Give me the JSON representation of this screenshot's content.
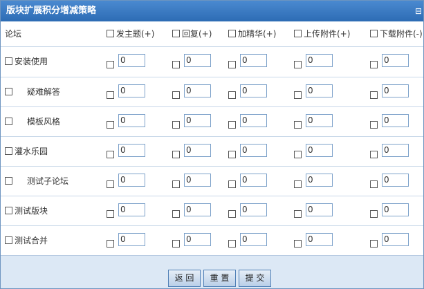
{
  "title": "版块扩展积分增减策略",
  "header": {
    "forum_label": "论坛",
    "columns": [
      "发主题(+)",
      "回复(+)",
      "加精华(+)",
      "上传附件(+)",
      "下载附件(-)"
    ]
  },
  "rows": [
    {
      "label": "安装使用",
      "values": [
        "0",
        "0",
        "0",
        "0",
        "0"
      ]
    },
    {
      "label": "疑难解答",
      "values": [
        "0",
        "0",
        "0",
        "0",
        "0"
      ]
    },
    {
      "label": "模板风格",
      "values": [
        "0",
        "0",
        "0",
        "0",
        "0"
      ]
    },
    {
      "label": "灌水乐园",
      "values": [
        "0",
        "0",
        "0",
        "0",
        "0"
      ]
    },
    {
      "label": "测试子论坛",
      "values": [
        "0",
        "0",
        "0",
        "0",
        "0"
      ]
    },
    {
      "label": "测试版块",
      "values": [
        "0",
        "0",
        "0",
        "0",
        "0"
      ]
    },
    {
      "label": "测试合并",
      "values": [
        "0",
        "0",
        "0",
        "0",
        "0"
      ]
    }
  ],
  "buttons": {
    "back": "返 回",
    "reset": "重 置",
    "submit": "提 交"
  }
}
